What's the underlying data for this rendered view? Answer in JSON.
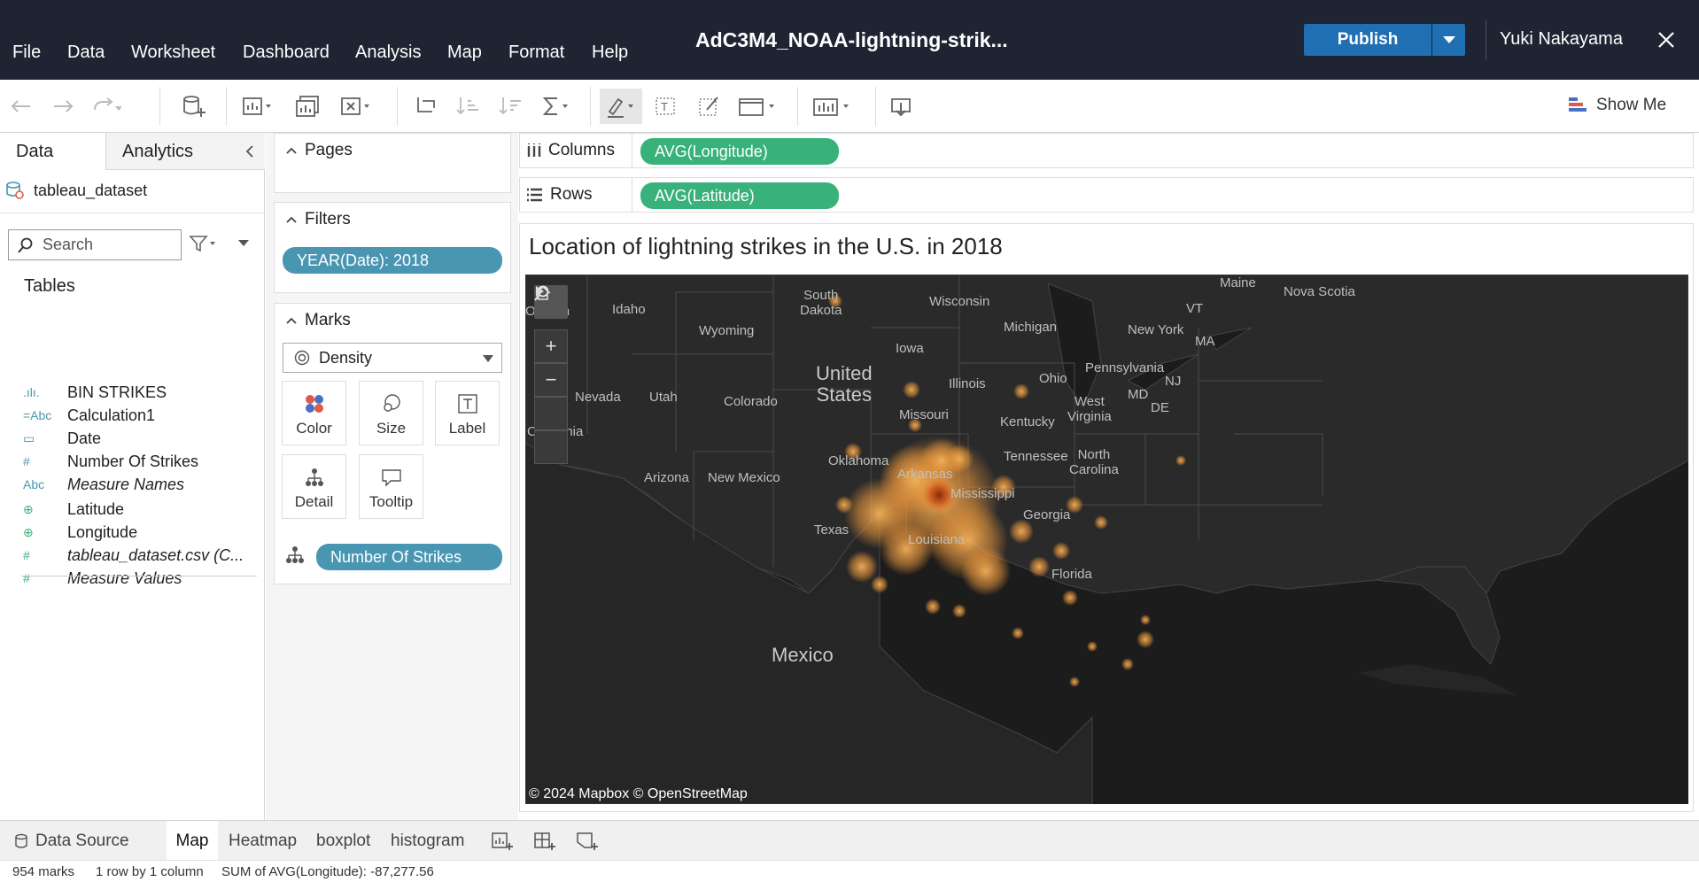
{
  "menu": [
    "File",
    "Data",
    "Worksheet",
    "Dashboard",
    "Analysis",
    "Map",
    "Format",
    "Help"
  ],
  "workbook_title": "AdC3M4_NOAA-lightning-strik...",
  "publish_label": "Publish",
  "user_name": "Yuki Nakayama",
  "show_me_label": "Show Me",
  "data_pane": {
    "tab_data": "Data",
    "tab_analytics": "Analytics",
    "datasource": "tableau_dataset",
    "search_placeholder": "Search",
    "tables_header": "Tables",
    "fields": [
      {
        "icon": "bin-icon",
        "glyph": ".ılı.",
        "label": "BIN STRIKES",
        "color": "#4996b2"
      },
      {
        "icon": "calc-string-icon",
        "glyph": "=Abc",
        "label": "Calculation1",
        "color": "#4996b2"
      },
      {
        "icon": "calendar-icon",
        "glyph": "▭",
        "label": "Date",
        "color": "#4996b2"
      },
      {
        "icon": "number-icon",
        "glyph": "#",
        "label": "Number Of Strikes",
        "color": "#4996b2"
      },
      {
        "icon": "string-icon",
        "glyph": "Abc",
        "label": "Measure Names",
        "color": "#4996b2",
        "italic": true
      },
      {
        "icon": "globe-icon",
        "glyph": "⊕",
        "label": "Latitude",
        "color": "#38b27a"
      },
      {
        "icon": "globe-icon",
        "glyph": "⊕",
        "label": "Longitude",
        "color": "#38b27a"
      },
      {
        "icon": "number-icon",
        "glyph": "#",
        "label": "tableau_dataset.csv (C...",
        "color": "#38b27a",
        "italic": true
      },
      {
        "icon": "number-icon",
        "glyph": "#",
        "label": "Measure Values",
        "color": "#38b27a",
        "italic": true
      }
    ]
  },
  "cards": {
    "pages_title": "Pages",
    "filters_title": "Filters",
    "filter_pill": "YEAR(Date): 2018",
    "marks_title": "Marks",
    "mark_type": "Density",
    "mark_buttons": [
      "Color",
      "Size",
      "Label",
      "Detail",
      "Tooltip"
    ],
    "detail_pill": "Number Of Strikes"
  },
  "shelves": {
    "columns_label": "Columns",
    "columns_pill": "AVG(Longitude)",
    "rows_label": "Rows",
    "rows_pill": "AVG(Latitude)"
  },
  "view": {
    "title": "Location of lightning strikes in the U.S. in 2018",
    "attribution": "© 2024 Mapbox  © OpenStreetMap",
    "map_labels": {
      "idaho": "Idaho",
      "oregon": "Oregon",
      "wyoming": "Wyoming",
      "south_dakota": "South\nDakota",
      "wisconsin": "Wisconsin",
      "michigan": "Michigan",
      "maine": "Maine",
      "nova_scotia": "Nova Scotia",
      "vt": "VT",
      "new_york": "New York",
      "ma": "MA",
      "iowa": "Iowa",
      "united_states": "United\nStates",
      "nevada": "Nevada",
      "utah": "Utah",
      "colorado": "Colorado",
      "illinois": "Illinois",
      "ohio": "Ohio",
      "pennsylvania": "Pennsylvania",
      "nj": "NJ",
      "md": "MD",
      "de": "DE",
      "missouri": "Missouri",
      "west_virginia": "West\nVirginia",
      "kentucky": "Kentucky",
      "california": "California",
      "oklahoma": "Oklahoma",
      "tennessee": "Tennessee",
      "north_carolina": "North\nCarolina",
      "arkansas": "Arkansas",
      "arizona": "Arizona",
      "new_mexico": "New Mexico",
      "mississippi": "Mississippi",
      "georgia": "Georgia",
      "texas": "Texas",
      "louisiana": "Louisiana",
      "florida": "Florida",
      "mexico": "Mexico"
    }
  },
  "sheet_tabs": {
    "data_source": "Data Source",
    "tabs": [
      "Map",
      "Heatmap",
      "boxplot",
      "histogram"
    ],
    "active": "Map"
  },
  "status": {
    "marks": "954 marks",
    "dims": "1 row by 1 column",
    "sum": "SUM of AVG(Longitude): -87,277.56"
  },
  "colors": {
    "topbar": "#1f2433",
    "publish": "#1f6fb2",
    "pill_blue": "#4996b2",
    "pill_green": "#38b27a",
    "map_bg": "#1c1c1c",
    "density_core": "#c8551a",
    "density_glow": "#f0a44a"
  }
}
